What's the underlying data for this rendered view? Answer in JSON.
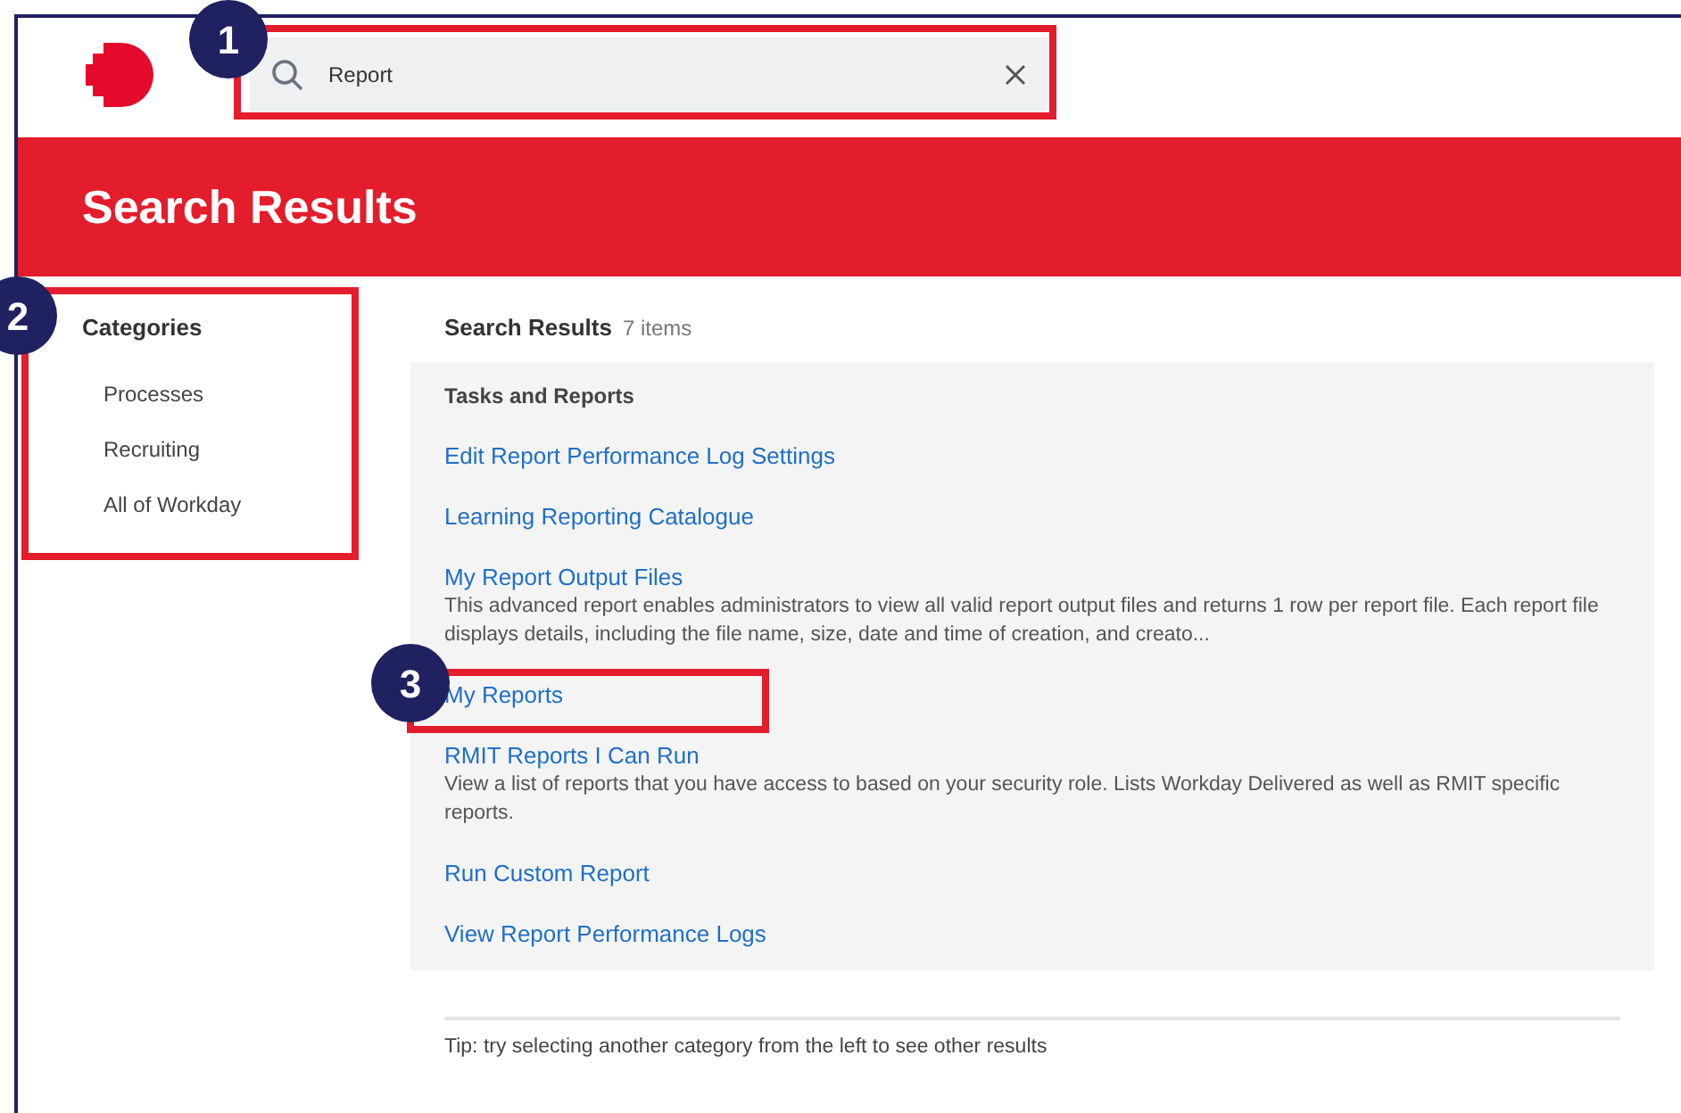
{
  "search": {
    "value": "Report"
  },
  "page_title": "Search Results",
  "categories": {
    "title": "Categories",
    "items": [
      "Processes",
      "Recruiting",
      "All of Workday"
    ]
  },
  "results": {
    "title": "Search Results",
    "count": "7 items",
    "section": "Tasks and Reports",
    "items": [
      {
        "title": "Edit Report Performance Log Settings"
      },
      {
        "title": "Learning Reporting Catalogue"
      },
      {
        "title": "My Report Output Files",
        "description": "This advanced report enables administrators to view all valid report output files and returns 1 row per report file. Each report file displays details, including the file name, size, date and time of creation, and creato..."
      },
      {
        "title": "My Reports"
      },
      {
        "title": "RMIT Reports I Can Run",
        "description": "View a list of reports that you have access to based on your security role. Lists Workday Delivered as well as RMIT specific reports."
      },
      {
        "title": "Run Custom Report"
      },
      {
        "title": "View Report Performance Logs"
      }
    ]
  },
  "tip": "Tip: try selecting another category from the left to see other results",
  "callouts": [
    {
      "number": "1"
    },
    {
      "number": "2"
    },
    {
      "number": "3"
    }
  ]
}
